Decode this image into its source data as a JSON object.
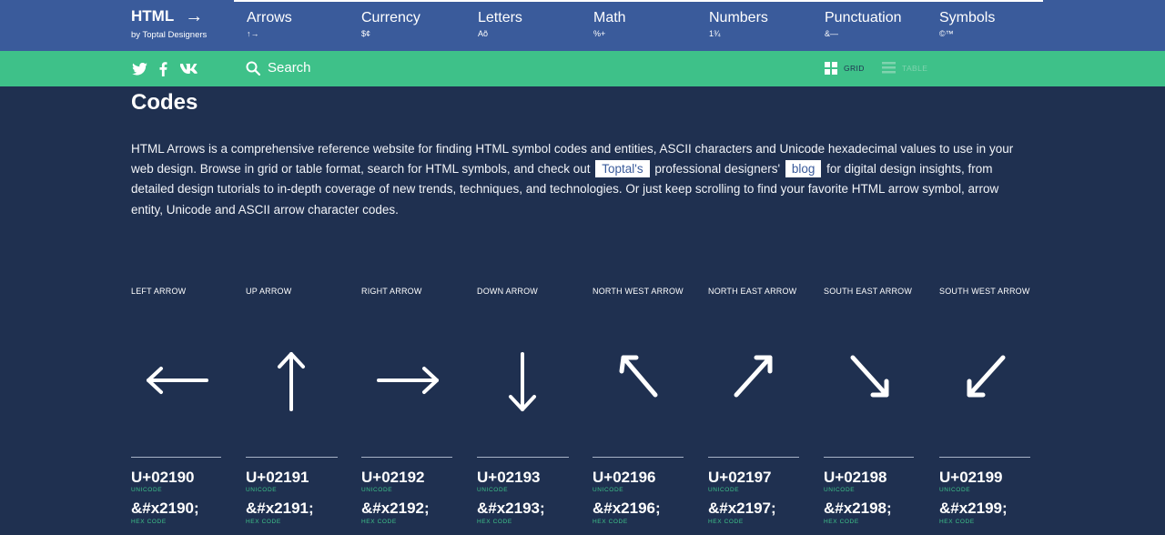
{
  "brand": {
    "title": "HTML",
    "arrow": "→",
    "subtitle": "by Toptal Designers"
  },
  "nav": [
    {
      "label": "Arrows",
      "sample": "↑→"
    },
    {
      "label": "Currency",
      "sample": "$¢"
    },
    {
      "label": "Letters",
      "sample": "Aõ"
    },
    {
      "label": "Math",
      "sample": "%+"
    },
    {
      "label": "Numbers",
      "sample": "1¾"
    },
    {
      "label": "Punctuation",
      "sample": "&—"
    },
    {
      "label": "Symbols",
      "sample": "©™"
    }
  ],
  "social": {
    "twitter": "twitter-icon",
    "facebook": "facebook-icon",
    "vk": "vk-icon"
  },
  "search": {
    "label": "Search"
  },
  "view": {
    "grid": "GRID",
    "table": "TABLE"
  },
  "page_title": "Codes",
  "intro": {
    "part1": "HTML Arrows is a comprehensive reference website for finding HTML symbol codes and entities, ASCII characters and Unicode hexadecimal values to use in your web design. Browse in grid or table format, search for HTML symbols, and check out",
    "link1": "Toptal's",
    "part2": "professional designers'",
    "link2": "blog",
    "part3": "for digital design insights, from detailed design tutorials to in-depth coverage of new trends, techniques, and technologies. Or just keep scrolling to find your favorite HTML arrow symbol, arrow entity, Unicode and ASCII arrow character codes."
  },
  "captions": {
    "unicode": "UNICODE",
    "hex": "HEX CODE"
  },
  "symbols": [
    {
      "name": "LEFT ARROW",
      "icon": "left-arrow",
      "unicode": "U+02190",
      "hex": "&#x2190;"
    },
    {
      "name": "UP ARROW",
      "icon": "up-arrow",
      "unicode": "U+02191",
      "hex": "&#x2191;"
    },
    {
      "name": "RIGHT ARROW",
      "icon": "right-arrow",
      "unicode": "U+02192",
      "hex": "&#x2192;"
    },
    {
      "name": "DOWN ARROW",
      "icon": "down-arrow",
      "unicode": "U+02193",
      "hex": "&#x2193;"
    },
    {
      "name": "NORTH WEST ARROW",
      "icon": "north-west-arrow",
      "unicode": "U+02196",
      "hex": "&#x2196;"
    },
    {
      "name": "NORTH EAST ARROW",
      "icon": "north-east-arrow",
      "unicode": "U+02197",
      "hex": "&#x2197;"
    },
    {
      "name": "SOUTH EAST ARROW",
      "icon": "south-east-arrow",
      "unicode": "U+02198",
      "hex": "&#x2198;"
    },
    {
      "name": "SOUTH WEST ARROW",
      "icon": "south-west-arrow",
      "unicode": "U+02199",
      "hex": "&#x2199;"
    }
  ],
  "colors": {
    "nav": "#3a5b9b",
    "accent": "#3ec189",
    "background": "#1f3050"
  }
}
